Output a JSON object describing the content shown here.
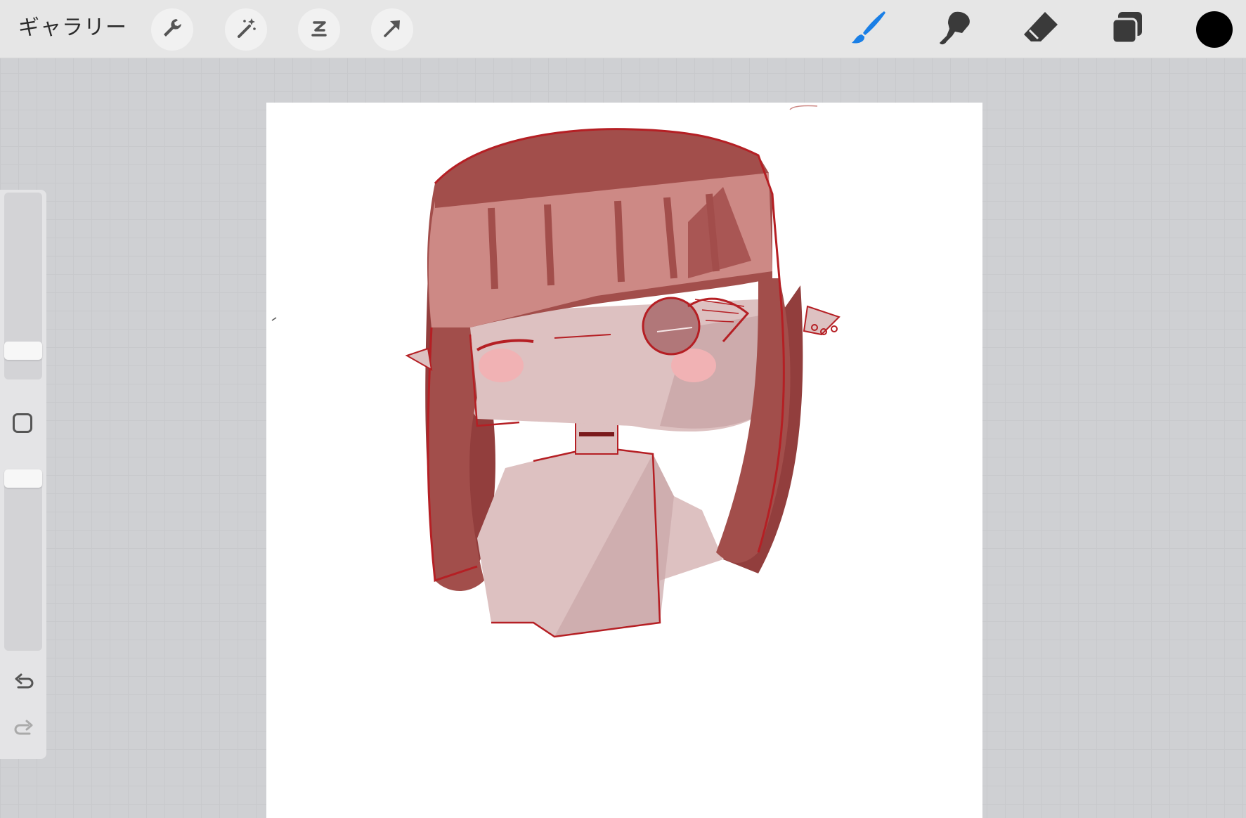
{
  "toolbar": {
    "gallery_label": "ギャラリー",
    "left_tools": [
      "wrench-icon",
      "magic-wand-icon",
      "selection-icon",
      "transform-arrow-icon"
    ],
    "right_tools": [
      "brush-icon",
      "smudge-icon",
      "eraser-icon",
      "layers-icon"
    ],
    "active_tool": "brush",
    "current_color": "#000000",
    "accent_color": "#1a7fe6"
  },
  "sidebar": {
    "brush_size_level": 0.18,
    "opacity_level": 1.0,
    "buttons": [
      "modify-square-icon",
      "undo-icon",
      "redo-icon"
    ]
  },
  "canvas": {
    "background": "#ffffff",
    "drawing_colors": [
      "#a24e4b",
      "#cd8985",
      "#923e3d",
      "#ddc1c1",
      "#f1b2b4",
      "#b51f24"
    ]
  }
}
